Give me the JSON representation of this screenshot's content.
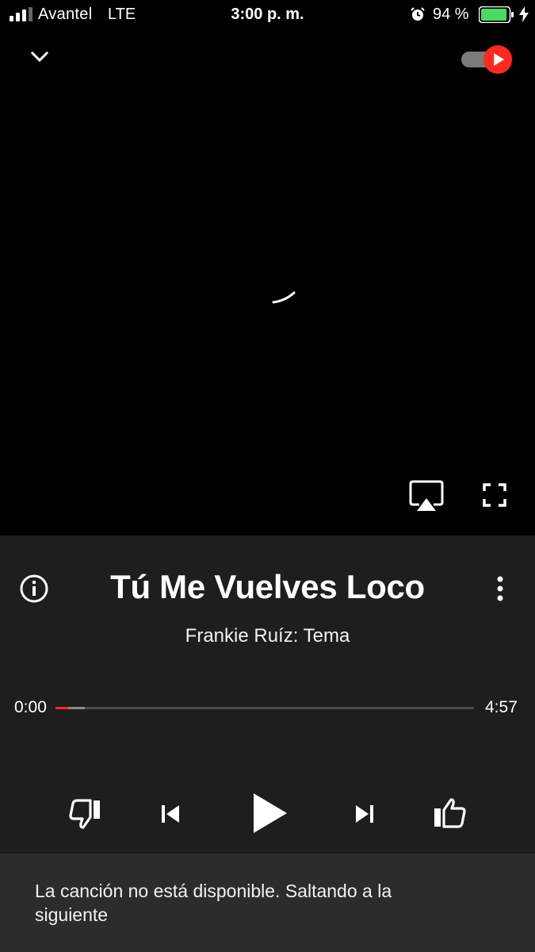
{
  "status_bar": {
    "carrier": "Avantel",
    "network": "LTE",
    "time": "3:00 p. m.",
    "battery_percent": "94 %",
    "battery_level": 0.94,
    "icons": [
      "signal-icon",
      "alarm-icon",
      "battery-icon",
      "charging-icon"
    ]
  },
  "header": {
    "collapse_icon": "chevron-down-icon",
    "toggle_icon": "play-toggle-icon",
    "toggle_on": true
  },
  "player": {
    "cast_icon": "airplay-icon",
    "fullscreen_icon": "fullscreen-icon",
    "loading": true
  },
  "song": {
    "title": "Tú Me Vuelves Loco",
    "subtitle": "Frankie Ruíz: Tema"
  },
  "progress": {
    "current": "0:00",
    "total": "4:57",
    "played_fraction": 0.03,
    "buffered_fraction": 0.07
  },
  "controls": {
    "icons": [
      "thumbs-down-icon",
      "previous-icon",
      "play-icon",
      "next-icon",
      "thumbs-up-icon"
    ]
  },
  "snackbar": {
    "message": "La canción no está disponible. Saltando a la siguiente"
  },
  "colors": {
    "accent": "#ff2a1f",
    "panel": "#1e1e1e",
    "snackbar": "#2c2c2c",
    "battery": "#4cd964"
  }
}
